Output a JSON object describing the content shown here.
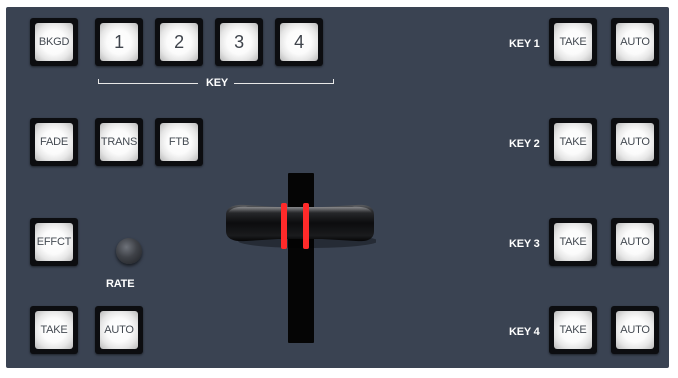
{
  "top_row": {
    "bkgd": "BKGD",
    "key1": "1",
    "key2": "2",
    "key3": "3",
    "key4": "4",
    "key_group_label": "KEY"
  },
  "transition_row": {
    "fade": "FADE",
    "trans": "TRANS",
    "ftb": "FTB"
  },
  "effect": {
    "effct": "EFFCT",
    "rate_label": "RATE"
  },
  "bottom_row": {
    "take": "TAKE",
    "auto": "AUTO"
  },
  "keyers": [
    {
      "label": "KEY 1",
      "take": "TAKE",
      "auto": "AUTO"
    },
    {
      "label": "KEY 2",
      "take": "TAKE",
      "auto": "AUTO"
    },
    {
      "label": "KEY 3",
      "take": "TAKE",
      "auto": "AUTO"
    },
    {
      "label": "KEY 4",
      "take": "TAKE",
      "auto": "AUTO"
    }
  ],
  "colors": {
    "panel": "#3a4352",
    "tbar_led": "#ff2a2a"
  },
  "icons": {
    "tbar": "t-bar-fader-handle",
    "knob": "rate-knob"
  }
}
